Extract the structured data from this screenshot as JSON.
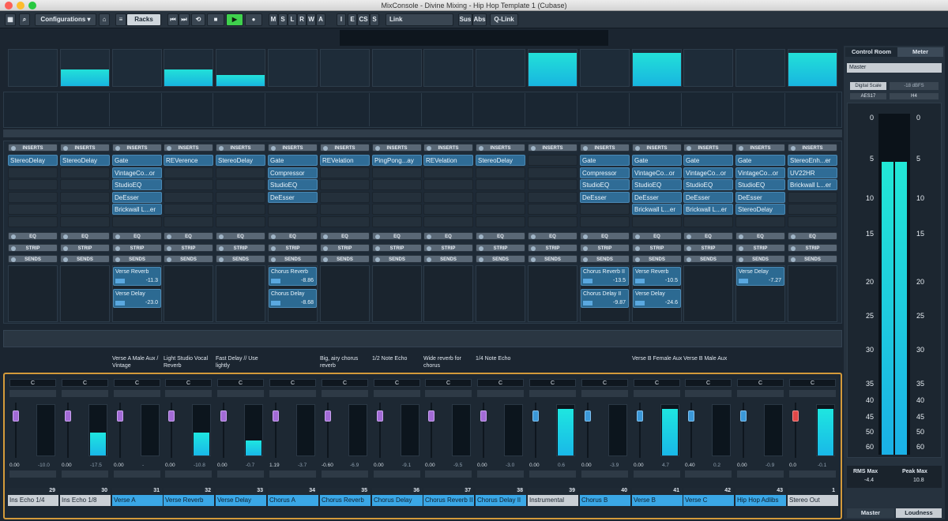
{
  "window": {
    "title": "MixConsole - Divine Mixing - Hip Hop Template 1 (Cubase)"
  },
  "toolbar": {
    "configurations": "Configurations",
    "racks": "Racks",
    "mode_buttons": [
      "M",
      "S",
      "L",
      "R",
      "W",
      "A"
    ],
    "insert_buttons": [
      "I",
      "E",
      "CS",
      "S"
    ],
    "link": "Link",
    "sus": "Sus",
    "abs": "Abs",
    "qlink": "Q-Link"
  },
  "section_labels": {
    "inserts": "INSERTS",
    "eq": "EQ",
    "strip": "STRIP",
    "sends": "SENDS"
  },
  "channels": [
    {
      "name": "Ins Echo 1/4",
      "num": "29",
      "color": "grey",
      "inserts": [
        "StereoDelay"
      ],
      "sends": [],
      "note": "",
      "pan": "C",
      "vol": "0.00",
      "peak": "-10.0",
      "fader": "purple",
      "level": 0.0
    },
    {
      "name": "Ins Echo 1/8",
      "num": "30",
      "color": "grey",
      "inserts": [
        "StereoDelay"
      ],
      "sends": [],
      "note": "",
      "pan": "C",
      "vol": "0.00",
      "peak": "-17.5",
      "fader": "purple",
      "level": 0.45
    },
    {
      "name": "Verse A",
      "num": "31",
      "color": "blue",
      "inserts": [
        "Gate",
        "VintageCo...or",
        "StudioEQ",
        "DeEsser",
        "Brickwall L...er"
      ],
      "sends": [
        {
          "name": "Verse Reverb",
          "value": "-11.3"
        },
        {
          "name": "Verse Delay",
          "value": "-23.0"
        }
      ],
      "note": "Verse A Male Aux / Vintage",
      "pan": "C",
      "vol": "0.00",
      "peak": "-",
      "fader": "purple",
      "level": 0.0
    },
    {
      "name": "Verse Reverb",
      "num": "32",
      "color": "blue",
      "inserts": [
        "REVerence"
      ],
      "sends": [],
      "note": "Light Studio Vocal Reverb",
      "pan": "C",
      "vol": "0.00",
      "peak": "-10.8",
      "fader": "purple",
      "level": 0.45
    },
    {
      "name": "Verse Delay",
      "num": "33",
      "color": "blue",
      "inserts": [
        "StereoDelay"
      ],
      "sends": [],
      "note": "Fast Delay // Use lightly",
      "pan": "C",
      "vol": "0.00",
      "peak": "-0.7",
      "fader": "purple",
      "level": 0.3
    },
    {
      "name": "Chorus A",
      "num": "34",
      "color": "blue",
      "inserts": [
        "Gate",
        "Compressor",
        "StudioEQ",
        "DeEsser"
      ],
      "sends": [
        {
          "name": "Chorus Reverb",
          "value": "-8.86"
        },
        {
          "name": "Chorus Delay",
          "value": "-8.68"
        }
      ],
      "note": "",
      "pan": "C",
      "vol": "1.19",
      "peak": "-3.7",
      "fader": "purple",
      "level": 0.0
    },
    {
      "name": "Chorus Reverb",
      "num": "35",
      "color": "blue",
      "inserts": [
        "REVelation"
      ],
      "sends": [],
      "note": "Big, airy chorus reverb",
      "pan": "C",
      "vol": "-0.60",
      "peak": "-6.9",
      "fader": "purple",
      "level": 0.0
    },
    {
      "name": "Chorus Delay",
      "num": "36",
      "color": "blue",
      "inserts": [
        "PingPong...ay"
      ],
      "sends": [],
      "note": "1/2 Note Echo",
      "pan": "C",
      "vol": "0.00",
      "peak": "-9.1",
      "fader": "purple",
      "level": 0.0
    },
    {
      "name": "Chorus Reverb II",
      "num": "37",
      "color": "blue",
      "inserts": [
        "REVelation"
      ],
      "sends": [],
      "note": "Wide reverb for chorus",
      "pan": "C",
      "vol": "0.00",
      "peak": "-9.5",
      "fader": "purple",
      "level": 0.0
    },
    {
      "name": "Chorus Delay II",
      "num": "38",
      "color": "blue",
      "inserts": [
        "StereoDelay"
      ],
      "sends": [],
      "note": "1/4 Note Echo",
      "pan": "C",
      "vol": "0.00",
      "peak": "-3.0",
      "fader": "purple",
      "level": 0.0
    },
    {
      "name": "Instrumental",
      "num": "39",
      "color": "grey",
      "inserts": [],
      "sends": [],
      "note": "",
      "pan": "C",
      "vol": "0.00",
      "peak": "0.6",
      "fader": "blue",
      "level": 0.92
    },
    {
      "name": "Chorus B",
      "num": "40",
      "color": "blue",
      "inserts": [
        "Gate",
        "Compressor",
        "StudioEQ",
        "DeEsser"
      ],
      "sends": [
        {
          "name": "Chorus Reverb II",
          "value": "-13.5"
        },
        {
          "name": "Chorus Delay II",
          "value": "-9.87"
        }
      ],
      "note": "",
      "pan": "C",
      "vol": "0.00",
      "peak": "-3.9",
      "fader": "blue",
      "level": 0.0
    },
    {
      "name": "Verse B",
      "num": "41",
      "color": "blue",
      "inserts": [
        "Gate",
        "VintageCo...or",
        "StudioEQ",
        "DeEsser",
        "Brickwall L...er"
      ],
      "sends": [
        {
          "name": "Verse Reverb",
          "value": "-10.5"
        },
        {
          "name": "Verse Delay",
          "value": "-24.6"
        }
      ],
      "note": "Verse B Female Aux",
      "pan": "C",
      "vol": "0.00",
      "peak": "4.7",
      "fader": "blue",
      "level": 0.92
    },
    {
      "name": "Verse C",
      "num": "42",
      "color": "blue",
      "inserts": [
        "Gate",
        "VintageCo...or",
        "StudioEQ",
        "DeEsser",
        "Brickwall L...er"
      ],
      "sends": [],
      "note": "Verse B Male Aux",
      "pan": "C",
      "vol": "0.40",
      "peak": "0.2",
      "fader": "blue",
      "level": 0.0
    },
    {
      "name": "Hip Hop Adlibs",
      "num": "43",
      "color": "blue",
      "inserts": [
        "Gate",
        "VintageCo...or",
        "StudioEQ",
        "DeEsser",
        "StereoDelay"
      ],
      "sends": [
        {
          "name": "Verse Delay",
          "value": "-7.27"
        }
      ],
      "note": "",
      "pan": "C",
      "vol": "0.00",
      "peak": "-0.9",
      "fader": "blue",
      "level": 0.0
    },
    {
      "name": "Stereo Out",
      "num": "1",
      "color": "grey",
      "inserts": [
        "StereoEnh...er",
        "UV22HR",
        "Brickwall L...er"
      ],
      "sends": [],
      "note": "",
      "pan": "C",
      "vol": "0.0",
      "peak": "-0.1",
      "fader": "red",
      "level": 0.92
    }
  ],
  "right_panel": {
    "tabs": [
      "Control Room",
      "Meter"
    ],
    "master_select": "Master",
    "digital_scale": "Digital Scale",
    "dbfs": "-18 dBFS",
    "ae": "AES17",
    "hold": "H4",
    "scale": [
      "0",
      "5",
      "10",
      "15",
      "20",
      "25",
      "30",
      "35",
      "40",
      "45",
      "50",
      "60"
    ],
    "level": 0.9,
    "rms_label": "RMS Max",
    "rms_value": "-4.4",
    "peak_label": "Peak Max",
    "peak_value": "10.8",
    "bottom_tabs": [
      "Master",
      "Loudness"
    ]
  }
}
